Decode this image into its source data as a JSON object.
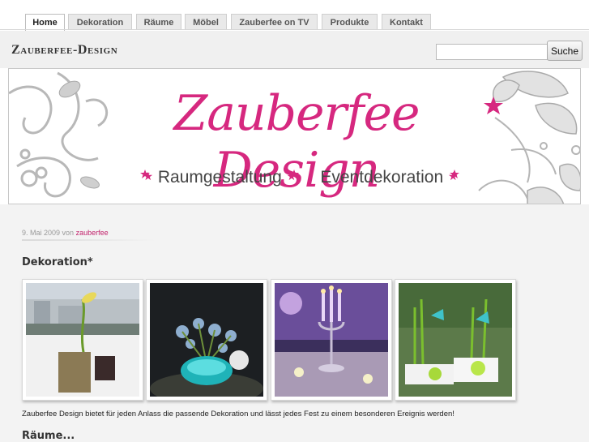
{
  "nav": {
    "tabs": [
      {
        "label": "Home",
        "active": true
      },
      {
        "label": "Dekoration"
      },
      {
        "label": "Räume"
      },
      {
        "label": "Möbel"
      },
      {
        "label": "Zauberfee on TV"
      },
      {
        "label": "Produkte"
      },
      {
        "label": "Kontakt"
      }
    ]
  },
  "header": {
    "site_title": "Zauberfee-Design",
    "search": {
      "value": "",
      "button_label": "Suche"
    }
  },
  "banner": {
    "title": "Zauberfee Design",
    "subtitle_parts": [
      "Raumgestaltung",
      "Eventdekoration"
    ],
    "star": "★",
    "accent_color": "#d6287f"
  },
  "post": {
    "date": "9. Mai 2009 von",
    "author": "zauberfee",
    "title": "Dekoration*",
    "images": [
      {
        "alt": "Calla lily arrangement by the waterfront"
      },
      {
        "alt": "Thistle arrangement in turquoise glass vase"
      },
      {
        "alt": "Candelabra with purple lighting"
      },
      {
        "alt": "Green apples and birds table decoration"
      }
    ],
    "text": "Zauberfee Design bietet für jeden Anlass die passende Dekoration und lässt jedes Fest zu einem besonderen Ereignis werden!"
  },
  "next_section": {
    "title": "Räume..."
  }
}
